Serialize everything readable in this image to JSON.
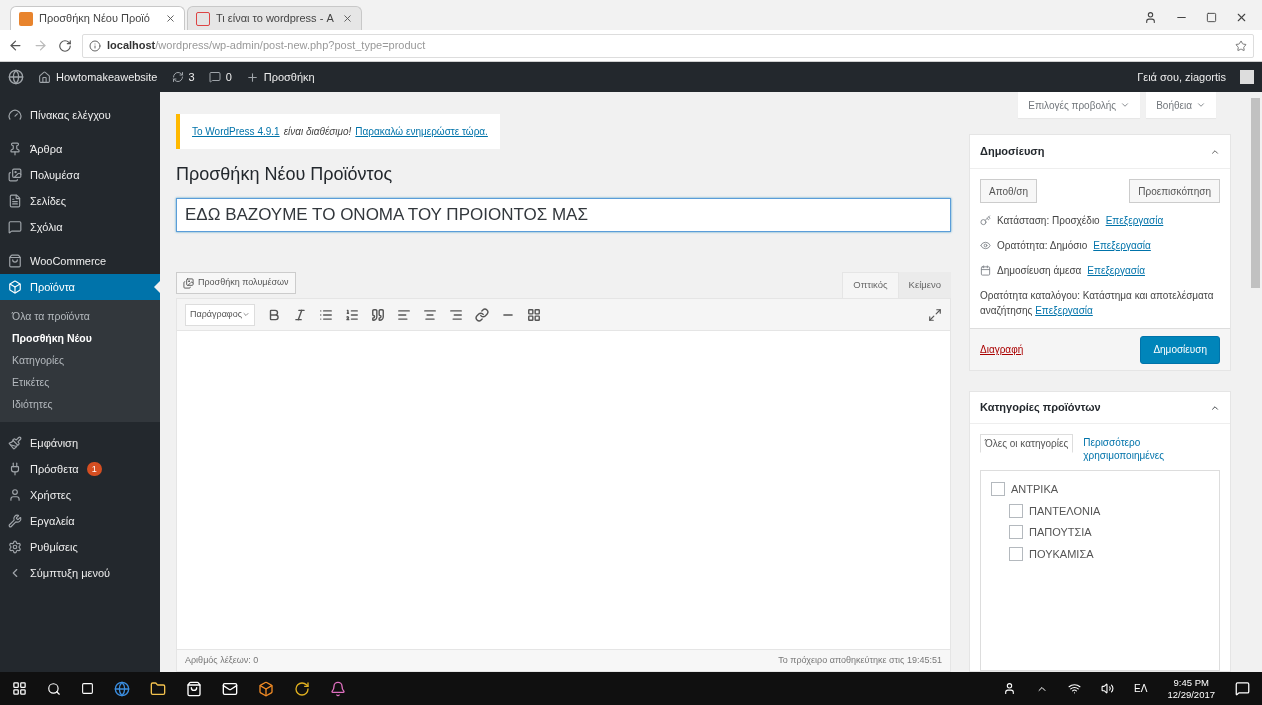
{
  "browser": {
    "tabs": [
      {
        "title": "Προσθήκη Νέου Προϊό",
        "selected": true
      },
      {
        "title": "Τι είναι το wordpress - Α",
        "selected": false
      }
    ],
    "url_host": "localhost",
    "url_path": "/wordpress/wp-admin/post-new.php?post_type=product"
  },
  "admin_bar": {
    "site": "Howtomakeawebsite",
    "updates": "3",
    "comments": "0",
    "new": "Προσθήκη",
    "greeting": "Γειά σου, ziagortis"
  },
  "sidebar": {
    "items": [
      {
        "label": "Πίνακας ελέγχου",
        "selected": false
      },
      {
        "label": "Άρθρα",
        "selected": false
      },
      {
        "label": "Πολυμέσα",
        "selected": false
      },
      {
        "label": "Σελίδες",
        "selected": false
      },
      {
        "label": "Σχόλια",
        "selected": false
      },
      {
        "label": "WooCommerce",
        "selected": false
      },
      {
        "label": "Προϊόντα",
        "selected": true,
        "children": [
          {
            "label": "Όλα τα προϊόντα",
            "selected": false
          },
          {
            "label": "Προσθήκη Νέου",
            "selected": true
          },
          {
            "label": "Κατηγορίες",
            "selected": false
          },
          {
            "label": "Ετικέτες",
            "selected": false
          },
          {
            "label": "Ιδιότητες",
            "selected": false
          }
        ]
      },
      {
        "label": "Εμφάνιση",
        "selected": false
      },
      {
        "label": "Πρόσθετα",
        "selected": false,
        "badge": "1"
      },
      {
        "label": "Χρήστες",
        "selected": false
      },
      {
        "label": "Εργαλεία",
        "selected": false
      },
      {
        "label": "Ρυθμίσεις",
        "selected": false
      },
      {
        "label": "Σύμπτυξη μενού",
        "selected": false
      }
    ]
  },
  "screen_options": [
    "Επιλογές προβολής",
    "Βοήθεια"
  ],
  "notice": {
    "link": "Το WordPress 4.9.1",
    "text": "είναι διαθέσιμο!",
    "link2": "Παρακαλώ ενημερώστε τώρα."
  },
  "page_title": "Προσθήκη Νέου Προϊόντος",
  "title_field": {
    "value": "ΕΔΩ ΒΑΖΟΥΜΕ ΤΟ ΟΝΟΜΑ ΤΟΥ ΠΡΟΙΟΝΤΟΣ ΜΑΣ"
  },
  "media_button": "Προσθήκη πολυμέσων",
  "editor_tabs": [
    {
      "label": "Οπτικός",
      "selected": true
    },
    {
      "label": "Κείμενο",
      "selected": false
    }
  ],
  "format_select": "Παράγραφος",
  "editor_footer": {
    "word_count": "Αριθμός λέξεων: 0",
    "saved": "Το πρόχειρο αποθηκεύτηκε στις 19:45:51"
  },
  "publish": {
    "title": "Δημοσίευση",
    "save": "Αποθ/ση",
    "preview": "Προεπισκόπηση",
    "rows": [
      {
        "label": "Κατάσταση: Προσχέδιο",
        "link": "Επεξεργασία"
      },
      {
        "label": "Ορατότητα: Δημόσιο",
        "link": "Επεξεργασία"
      },
      {
        "label": "Δημοσίευση άμεσα",
        "link": "Επεξεργασία"
      }
    ],
    "catalog": {
      "text": "Ορατότητα καταλόγου: Κατάστημα και αποτελέσματα αναζήτησης",
      "link": "Επεξεργασία"
    },
    "delete": "Διαγραφή",
    "publish": "Δημοσίευση"
  },
  "categories": {
    "title": "Κατηγορίες προϊόντων",
    "tabs": [
      {
        "label": "Όλες οι κατηγορίες",
        "selected": true
      },
      {
        "label": "Περισσότερο χρησιμοποιημένες",
        "selected": false
      }
    ],
    "tree": [
      {
        "label": "ΑΝΤΡΙΚΑ",
        "checked": false,
        "children": [
          {
            "label": "ΠΑΝΤΕΛΟΝΙΑ",
            "checked": false
          },
          {
            "label": "ΠΑΠΟΥΤΣΙΑ",
            "checked": false
          },
          {
            "label": "ΠΟΥΚΑΜΙΣΑ",
            "checked": false
          }
        ]
      }
    ]
  },
  "taskbar": {
    "lang": "ΕΛ",
    "time": "9:45 PM",
    "date": "12/29/2017"
  }
}
